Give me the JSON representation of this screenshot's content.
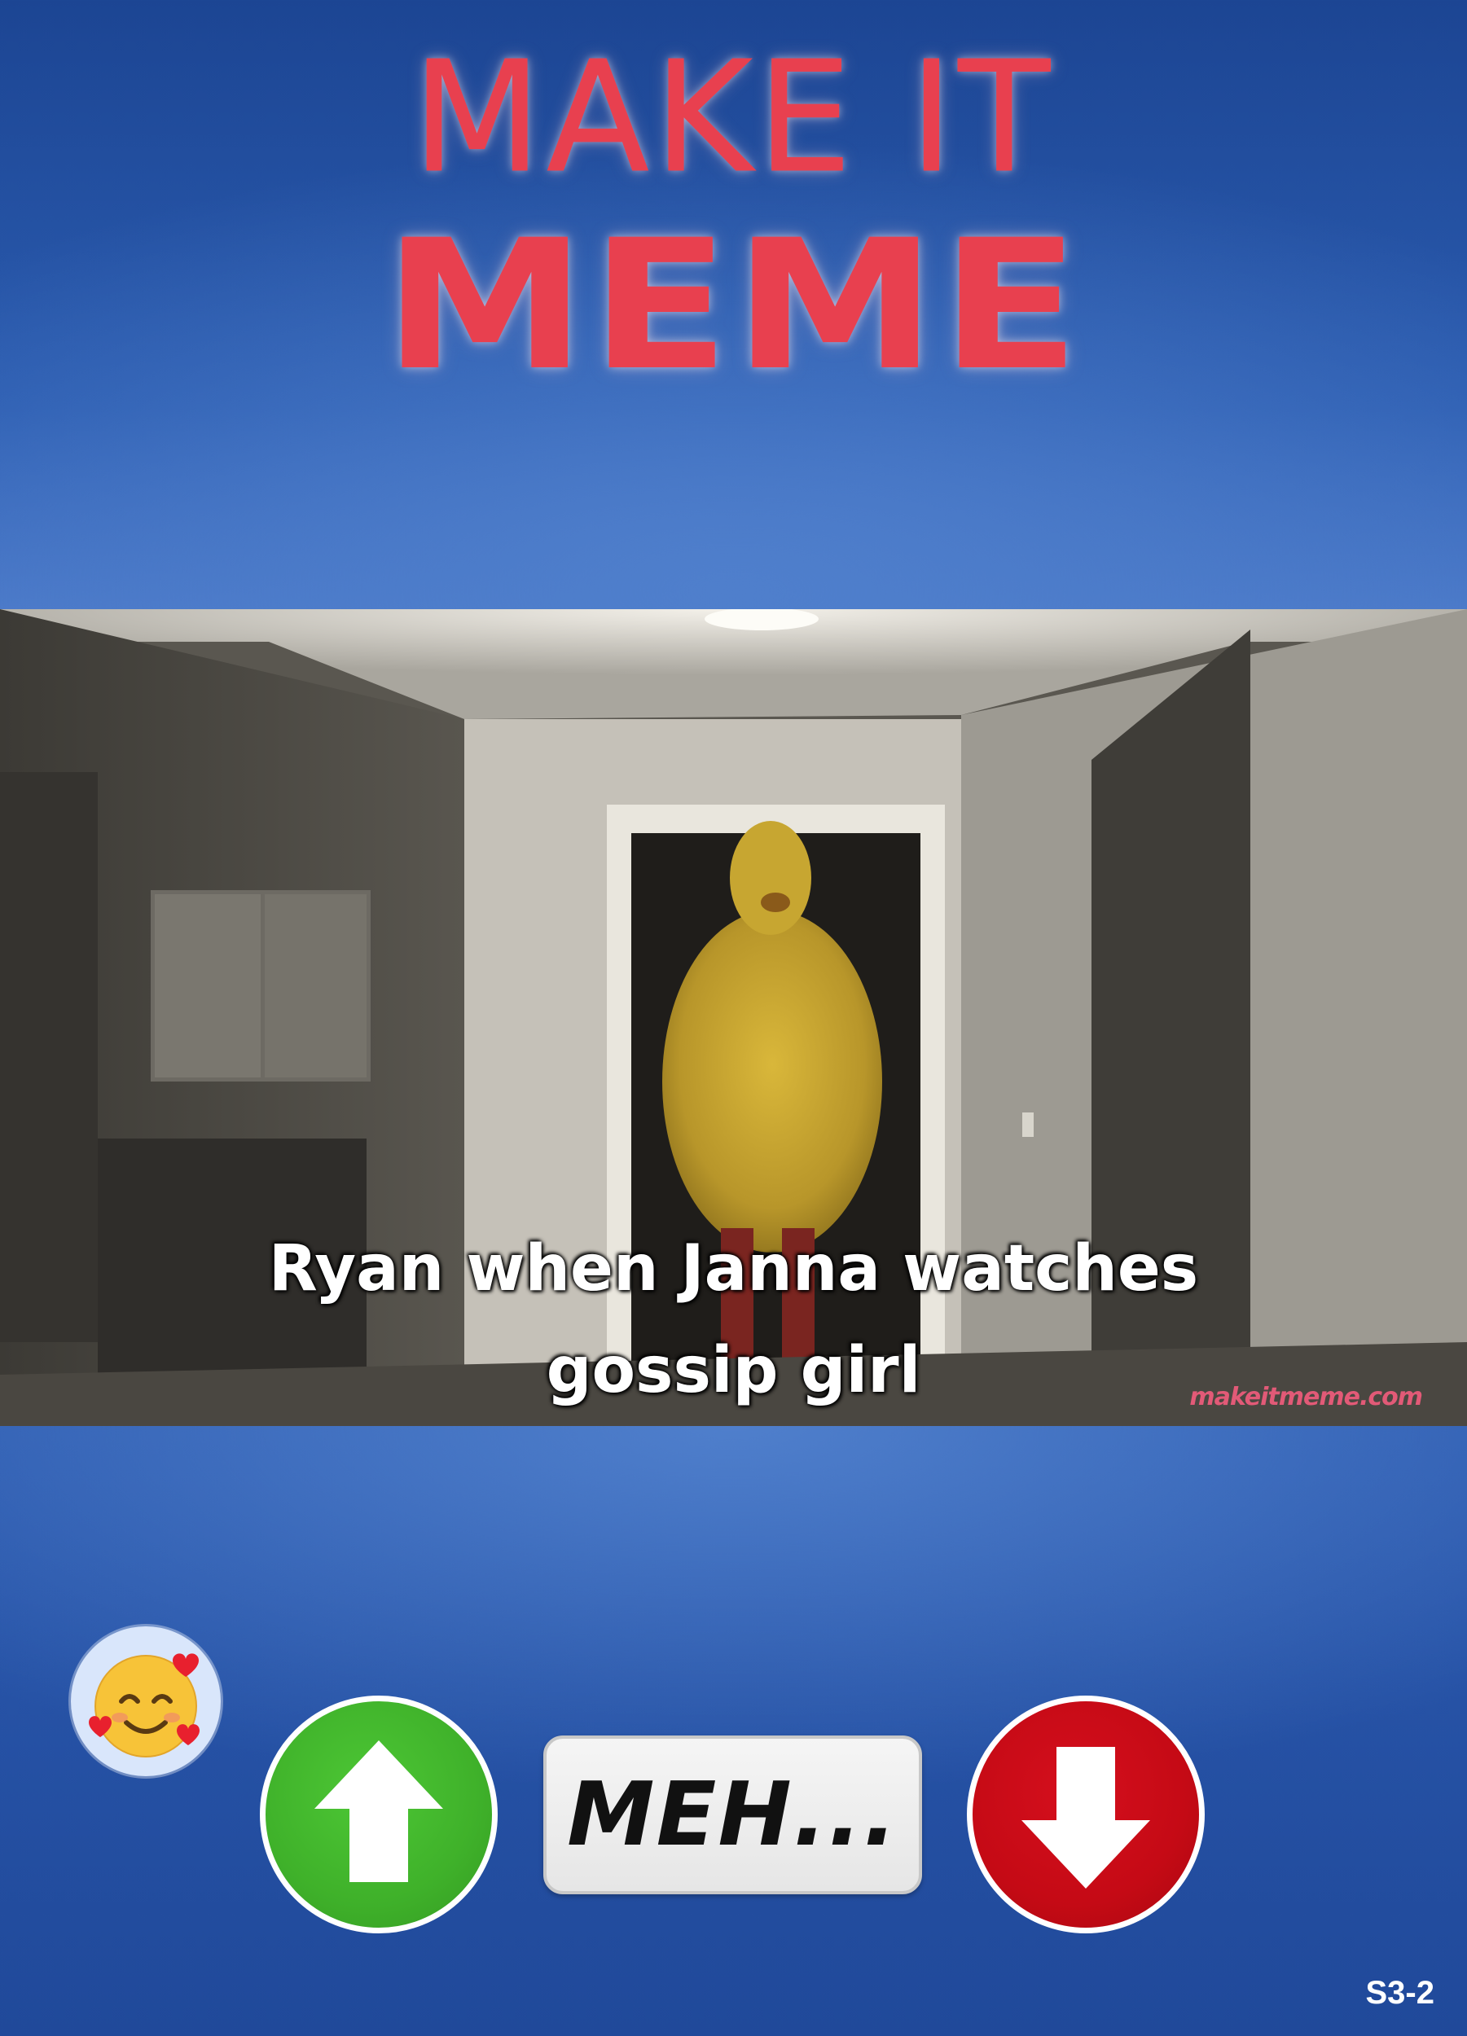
{
  "logo": {
    "line1": "MAKE IT",
    "line2": "MEME",
    "color": "#e8404f"
  },
  "meme": {
    "caption_line1": "Ryan when Janna watches",
    "caption_line2": "gossip girl",
    "watermark": "makeitmeme.com"
  },
  "reaction": {
    "icon": "smiling-face-with-hearts-icon"
  },
  "controls": {
    "upvote_icon": "arrow-up-icon",
    "upvote_color": "#3fb12a",
    "meh_label": "MEH...",
    "downvote_icon": "arrow-down-icon",
    "downvote_color": "#c50a15"
  },
  "footer": {
    "slide_id": "S3-2"
  }
}
